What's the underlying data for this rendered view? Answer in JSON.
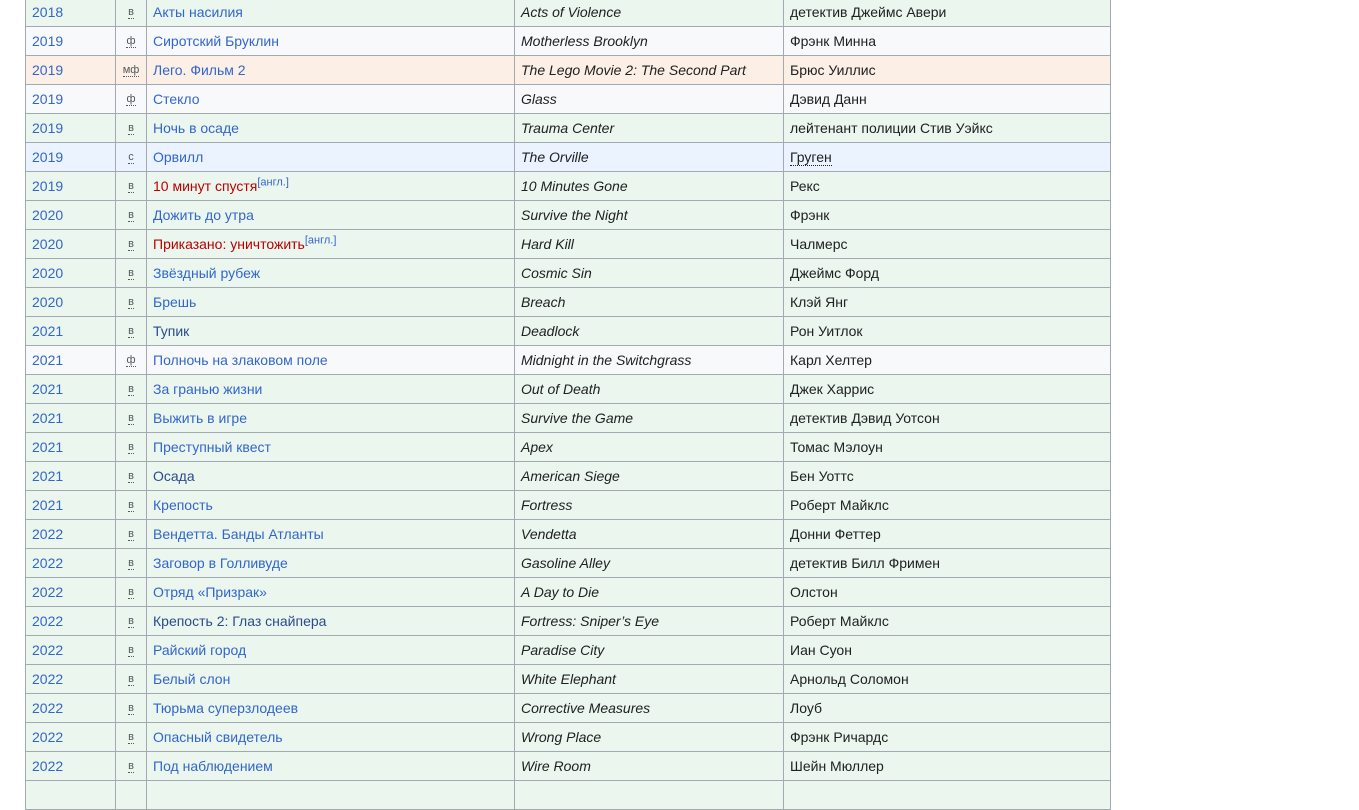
{
  "table": {
    "rows": [
      {
        "year": "2018",
        "type": "в",
        "title_ru": "Акты насилия",
        "title_en": "Acts of Violence",
        "role": "детектив Джеймс Авери",
        "kind": "v"
      },
      {
        "year": "2019",
        "type": "ф",
        "title_ru": "Сиротский Бруклин",
        "title_en": "Motherless Brooklyn",
        "role": "Фрэнк Минна",
        "kind": "f"
      },
      {
        "year": "2019",
        "type": "мф",
        "title_ru": "Лего. Фильм 2",
        "title_en": "The Lego Movie 2: The Second Part",
        "role": "Брюс Уиллис",
        "kind": "mf"
      },
      {
        "year": "2019",
        "type": "ф",
        "title_ru": "Стекло",
        "title_en": "Glass",
        "role": "Дэвид Данн",
        "kind": "f"
      },
      {
        "year": "2019",
        "type": "в",
        "title_ru": "Ночь в осаде",
        "title_en": "Trauma Center",
        "role": "лейтенант полиции Стив Уэйкс",
        "kind": "v"
      },
      {
        "year": "2019",
        "type": "с",
        "title_ru": "Орвилл",
        "title_en": "The Orville",
        "role": "Груген",
        "kind": "s",
        "role_abbr": true
      },
      {
        "year": "2019",
        "type": "в",
        "title_ru": "10 минут спустя",
        "title_en": "10 Minutes Gone",
        "role": "Рекс",
        "kind": "v",
        "red": true,
        "cite": "[англ.]"
      },
      {
        "year": "2020",
        "type": "в",
        "title_ru": "Дожить до утра",
        "title_en": "Survive the Night",
        "role": "Фрэнк",
        "kind": "v"
      },
      {
        "year": "2020",
        "type": "в",
        "title_ru": "Приказано: уничтожить",
        "title_en": "Hard Kill",
        "role": "Чалмерс",
        "kind": "v",
        "red": true,
        "cite": "[англ.]"
      },
      {
        "year": "2020",
        "type": "в",
        "title_ru": "Звёздный рубеж",
        "title_en": "Cosmic Sin",
        "role": "Джеймс Форд",
        "kind": "v"
      },
      {
        "year": "2020",
        "type": "в",
        "title_ru": "Брешь",
        "title_en": "Breach",
        "role": "Клэй Янг",
        "kind": "v"
      },
      {
        "year": "2021",
        "type": "в",
        "title_ru": "Тупик",
        "title_en": "Deadlock",
        "role": "Рон Уитлок",
        "kind": "v",
        "visited": true
      },
      {
        "year": "2021",
        "type": "ф",
        "title_ru": "Полночь на злаковом поле",
        "title_en": "Midnight in the Switchgrass",
        "role": "Карл Хелтер",
        "kind": "f"
      },
      {
        "year": "2021",
        "type": "в",
        "title_ru": "За гранью жизни",
        "title_en": "Out of Death",
        "role": "Джек Харрис",
        "kind": "v"
      },
      {
        "year": "2021",
        "type": "в",
        "title_ru": "Выжить в игре",
        "title_en": "Survive the Game",
        "role": "детектив Дэвид Уотсон",
        "kind": "v"
      },
      {
        "year": "2021",
        "type": "в",
        "title_ru": "Преступный квест",
        "title_en": "Apex",
        "role": "Томас Мэлоун",
        "kind": "v"
      },
      {
        "year": "2021",
        "type": "в",
        "title_ru": "Осада",
        "title_en": "American Siege",
        "role": "Бен Уоттс",
        "kind": "v",
        "visited": true
      },
      {
        "year": "2021",
        "type": "в",
        "title_ru": "Крепость",
        "title_en": "Fortress",
        "role": "Роберт Майклс",
        "kind": "v"
      },
      {
        "year": "2022",
        "type": "в",
        "title_ru": "Вендетта. Банды Атланты",
        "title_en": "Vendetta",
        "role": "Донни Феттер",
        "kind": "v"
      },
      {
        "year": "2022",
        "type": "в",
        "title_ru": "Заговор в Голливуде",
        "title_en": "Gasoline Alley",
        "role": "детектив Билл Фримен",
        "kind": "v"
      },
      {
        "year": "2022",
        "type": "в",
        "title_ru": "Отряд «Призрак»",
        "title_en": "A Day to Die",
        "role": "Олстон",
        "kind": "v"
      },
      {
        "year": "2022",
        "type": "в",
        "title_ru": "Крепость 2: Глаз снайпера",
        "title_en": "Fortress: Sniper’s Eye",
        "role": "Роберт Майклс",
        "kind": "v",
        "visited": true
      },
      {
        "year": "2022",
        "type": "в",
        "title_ru": "Райский город",
        "title_en": "Paradise City",
        "role": "Иан Суон",
        "kind": "v"
      },
      {
        "year": "2022",
        "type": "в",
        "title_ru": "Белый слон",
        "title_en": "White Elephant",
        "role": "Арнольд Соломон",
        "kind": "v"
      },
      {
        "year": "2022",
        "type": "в",
        "title_ru": "Тюрьма суперзлодеев",
        "title_en": "Corrective Measures",
        "role": "Лоуб",
        "kind": "v"
      },
      {
        "year": "2022",
        "type": "в",
        "title_ru": "Опасный свидетель",
        "title_en": "Wrong Place",
        "role": "Фрэнк Ричардс",
        "kind": "v"
      },
      {
        "year": "2022",
        "type": "в",
        "title_ru": "Под наблюдением",
        "title_en": "Wire Room",
        "role": "Шейн Мюллер",
        "kind": "v"
      },
      {
        "year": "",
        "type": "",
        "title_ru": "",
        "title_en": "",
        "role": "",
        "kind": "v"
      }
    ]
  }
}
